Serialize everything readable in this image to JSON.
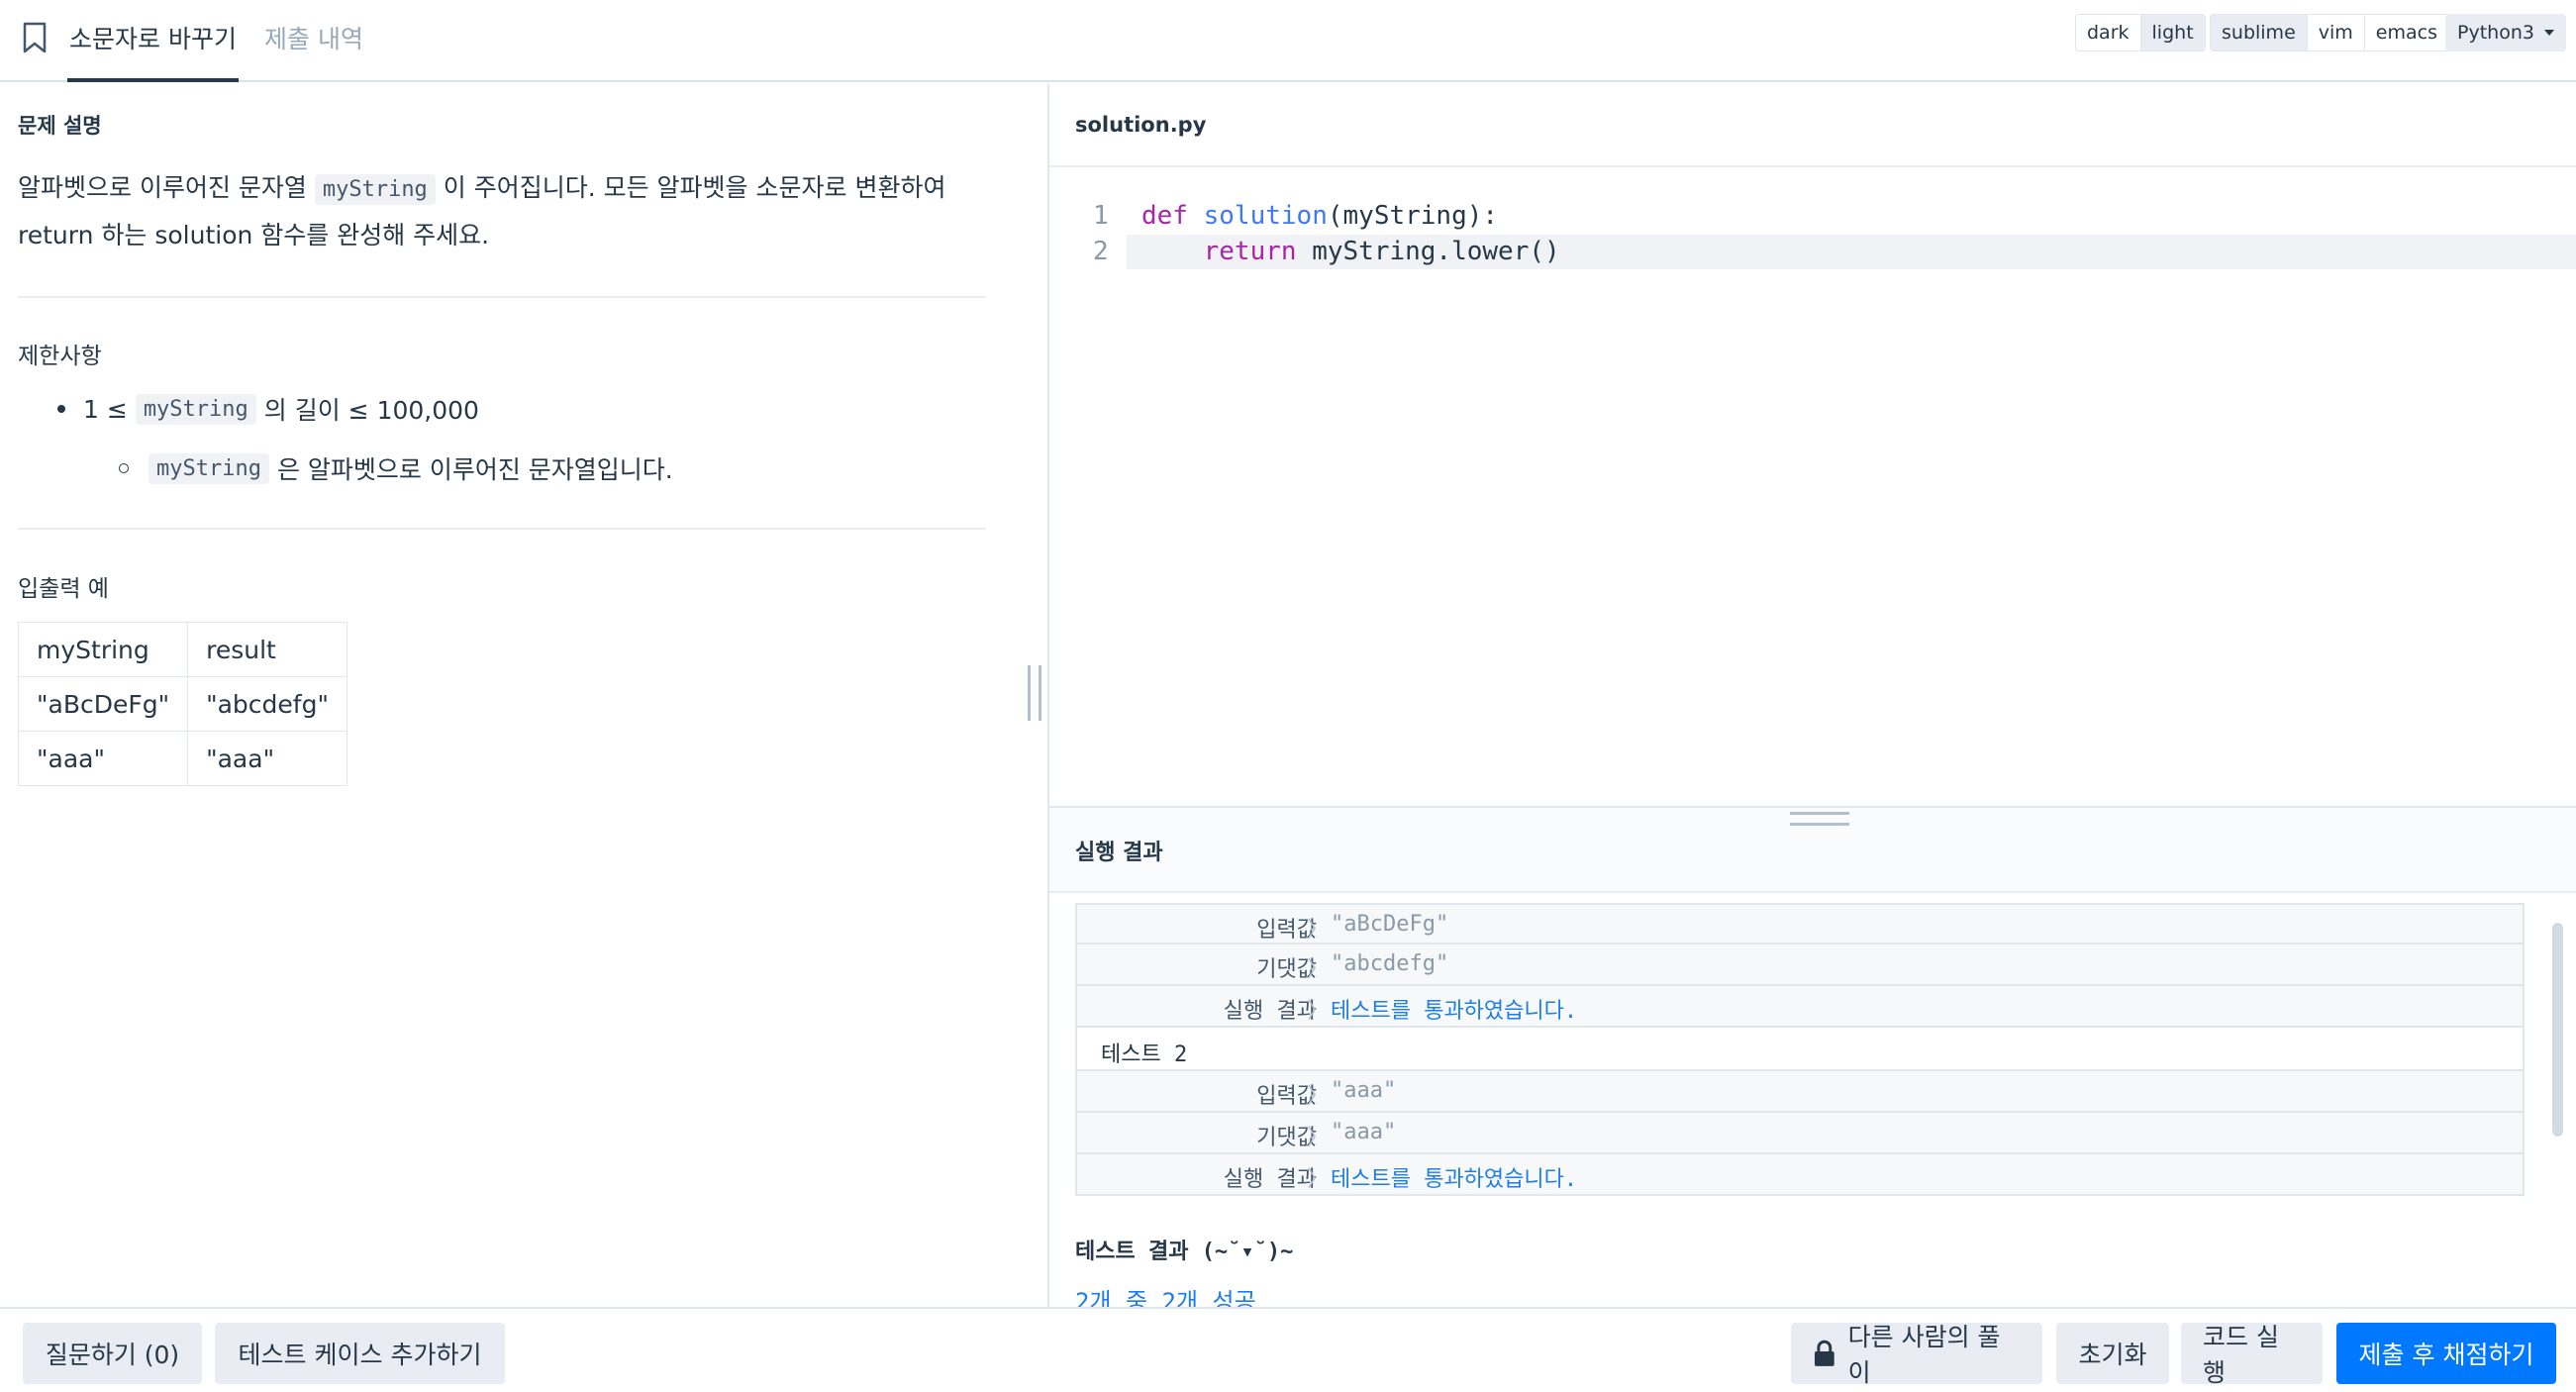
{
  "header": {
    "tabs": [
      {
        "label": "소문자로 바꾸기",
        "active": true
      },
      {
        "label": "제출 내역",
        "active": false
      }
    ],
    "theme_options": [
      "dark",
      "light"
    ],
    "theme_selected": "light",
    "keymap_options": [
      "sublime",
      "vim",
      "emacs"
    ],
    "language": "Python3"
  },
  "problem": {
    "desc_heading": "문제 설명",
    "desc_before": "알파벳으로 이루어진 문자열 ",
    "desc_code": "myString",
    "desc_after": " 이 주어집니다. 모든 알파벳을 소문자로 변환하여 return 하는 solution 함수를 완성해 주세요.",
    "constraints_heading": "제한사항",
    "constraint1_pre": "1 ≤",
    "constraint1_code": "myString",
    "constraint1_post": "의 길이 ≤ 100,000",
    "constraint2_code": "myString",
    "constraint2_post": "은 알파벳으로 이루어진 문자열입니다.",
    "io_heading": "입출력 예",
    "io_table": {
      "headers": [
        "myString",
        "result"
      ],
      "rows": [
        [
          "\"aBcDeFg\"",
          "\"abcdefg\""
        ],
        [
          "\"aaa\"",
          "\"aaa\""
        ]
      ]
    }
  },
  "editor": {
    "filename": "solution.py",
    "lines": [
      {
        "num": "1",
        "kw": "def",
        "fn": "solution",
        "rest": "(myString):"
      },
      {
        "num": "2",
        "kw": "return",
        "rest": " myString.lower()"
      }
    ]
  },
  "output": {
    "heading": "실행 결과",
    "test1": {
      "input_label": "입력값",
      "input": "\"aBcDeFg\"",
      "expected_label": "기댓값",
      "expected": "\"abcdefg\"",
      "result_label": "실행 결과",
      "result": "테스트를 통과하였습니다."
    },
    "test2_title": "테스트 2",
    "test2": {
      "input_label": "입력값",
      "input": "\"aaa\"",
      "expected_label": "기댓값",
      "expected": "\"aaa\"",
      "result_label": "실행 결과",
      "result": "테스트를 통과하였습니다."
    },
    "summary_title": "테스트 결과 (~˘▾˘)~",
    "summary": "2개 중 2개 성공"
  },
  "footer": {
    "question_button": "질문하기 (0)",
    "add_testcase_button": "테스트 케이스 추가하기",
    "others_solution_button": "다른 사람의 풀이",
    "reset_button": "초기화",
    "run_button": "코드 실행",
    "submit_button": "제출 후 채점하기"
  },
  "colors": {
    "primary": "#0078ff",
    "pass": "#1d7ee7",
    "keyword": "#a626a4",
    "function": "#4078f2"
  }
}
